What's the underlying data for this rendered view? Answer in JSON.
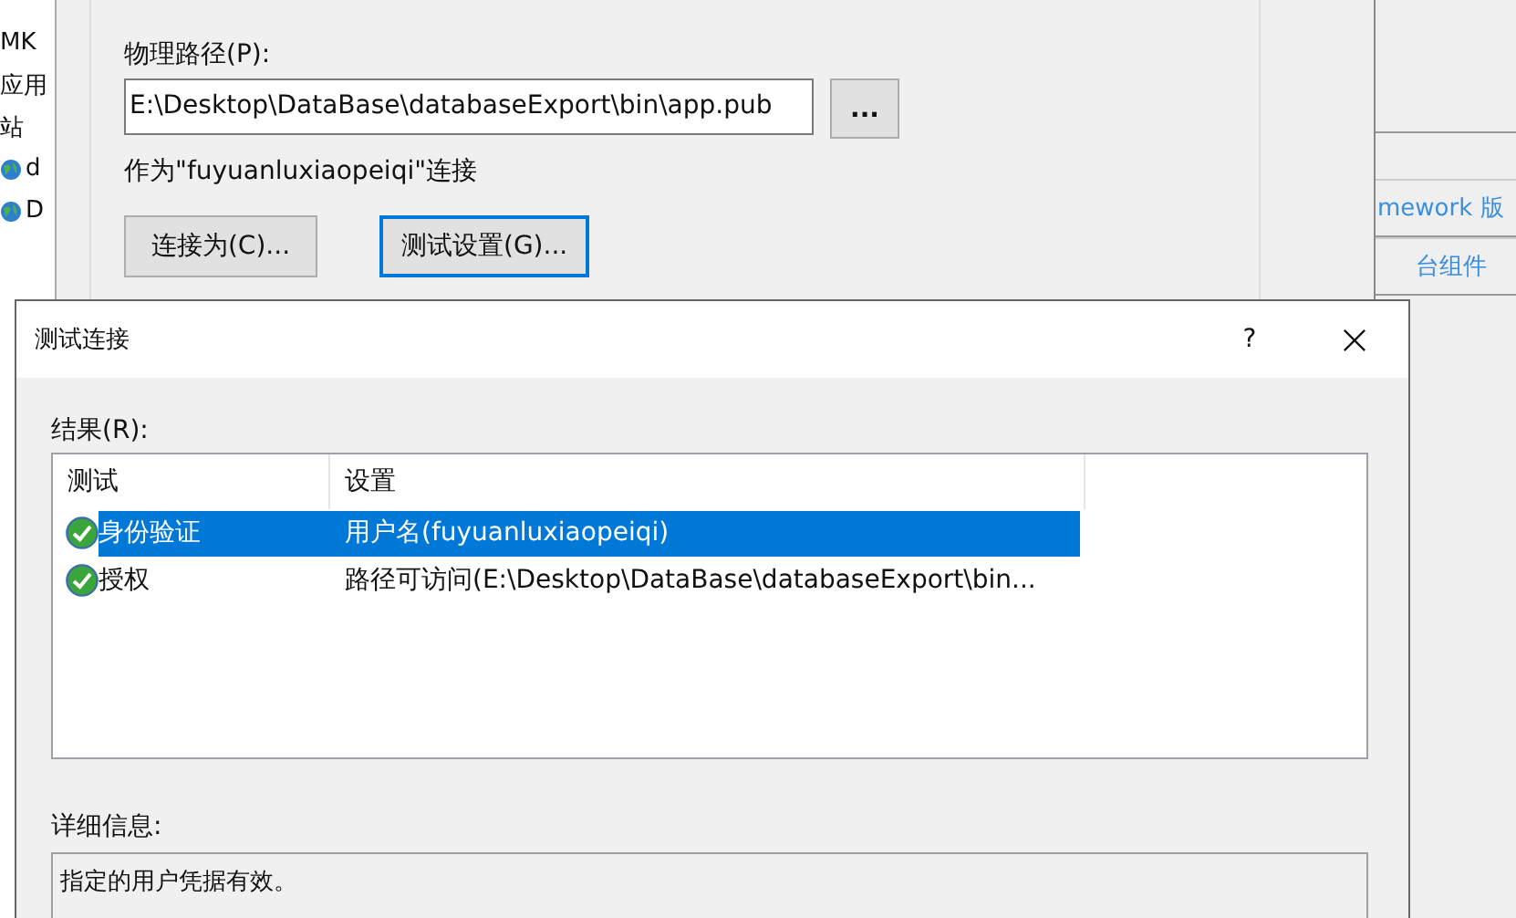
{
  "background_window": {
    "sidebar_items": [
      {
        "label": "MK",
        "kind": "text"
      },
      {
        "label": "应用",
        "kind": "text"
      },
      {
        "label": "站",
        "kind": "text"
      },
      {
        "label": "d",
        "kind": "site"
      },
      {
        "label": "D",
        "kind": "site"
      }
    ],
    "content_directory": {
      "path_label": "物理路径(P):",
      "path_value": "E:\\Desktop\\DataBase\\databaseExport\\bin\\app.pub",
      "browse_button": "...",
      "connect_as_text": "作为\"fuyuanluxiaopeiqi\"连接",
      "buttons": [
        {
          "label": "连接为(C)...",
          "focused": false
        },
        {
          "label": "测试设置(G)...",
          "focused": true
        }
      ]
    },
    "actions": [
      "mework 版",
      "台组件"
    ]
  },
  "dialog": {
    "title": "测试连接",
    "help": "?",
    "results_label": "结果(R):",
    "columns": [
      "测试",
      "设置"
    ],
    "rows": [
      {
        "test": "身份验证",
        "setting": "用户名(fuyuanluxiaopeiqi)",
        "passed": true,
        "selected": true
      },
      {
        "test": "授权",
        "setting": "路径可访问(E:\\Desktop\\DataBase\\databaseExport\\bin...",
        "passed": true,
        "selected": false
      }
    ],
    "details_label": "详细信息:",
    "details_text": "指定的用户凭据有效。"
  }
}
